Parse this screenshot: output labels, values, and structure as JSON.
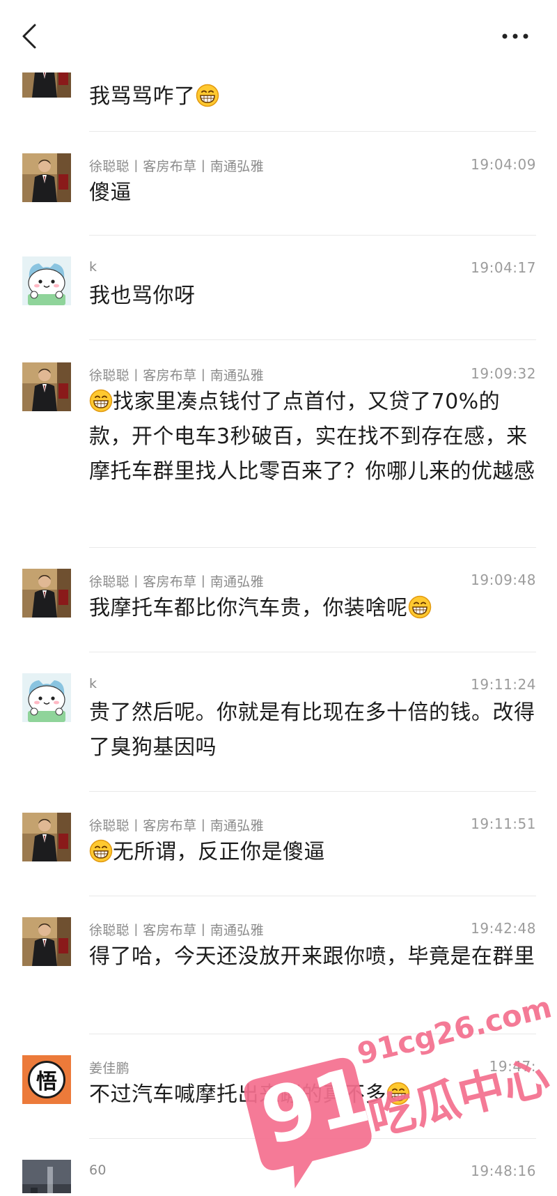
{
  "nav": {
    "back_icon": "chevron-left-icon",
    "more_icon": "more-horizontal-icon"
  },
  "messages": [
    {
      "avatar": "man-in-suit-photo",
      "sender": "",
      "time": "",
      "text_before": "我骂骂咋了",
      "emoji_after": "grinning-face-emoji"
    },
    {
      "avatar": "man-in-suit-photo",
      "sender": "徐聪聪丨客房布草丨南通弘雅",
      "time": "19:04:09",
      "text": "傻逼"
    },
    {
      "avatar": "cartoon-cat",
      "sender": "k",
      "time": "19:04:17",
      "text": "我也骂你呀"
    },
    {
      "avatar": "man-in-suit-photo",
      "sender": "徐聪聪丨客房布草丨南通弘雅",
      "time": "19:09:32",
      "emoji_before": "grinning-face-emoji",
      "text": "找家里凑点钱付了点首付，又贷了70%的款，开个电车3秒破百，实在找不到存在感，来摩托车群里找人比零百来了？你哪儿来的优越感"
    },
    {
      "avatar": "man-in-suit-photo",
      "sender": "徐聪聪丨客房布草丨南通弘雅",
      "time": "19:09:48",
      "text_before": "我摩托车都比你汽车贵，你装啥呢",
      "emoji_after": "grinning-face-emoji"
    },
    {
      "avatar": "cartoon-cat",
      "sender": "k",
      "time": "19:11:24",
      "text": "贵了然后呢。你就是有比现在多十倍的钱。改得了臭狗基因吗"
    },
    {
      "avatar": "man-in-suit-photo",
      "sender": "徐聪聪丨客房布草丨南通弘雅",
      "time": "19:11:51",
      "emoji_before": "grinning-face-emoji",
      "text": "无所谓，反正你是傻逼"
    },
    {
      "avatar": "man-in-suit-photo",
      "sender": "徐聪聪丨客房布草丨南通弘雅",
      "time": "19:42:48",
      "text": "得了哈，今天还没放开来跟你喷，毕竟是在群里"
    },
    {
      "avatar": "wu-character-logo",
      "avatar_char": "悟",
      "sender": "姜佳鹏",
      "time": "19:47:",
      "text_before": "不过汽车喊摩托出来蹦的真不多",
      "emoji_after": "grinning-face-emoji"
    },
    {
      "avatar": "dark-photo",
      "sender": "60",
      "time": "19:48:16",
      "text": ""
    }
  ],
  "watermark": {
    "number": "91",
    "domain": "91cg26.com",
    "label": "吃瓜中心",
    "color": "#f46f8e"
  }
}
